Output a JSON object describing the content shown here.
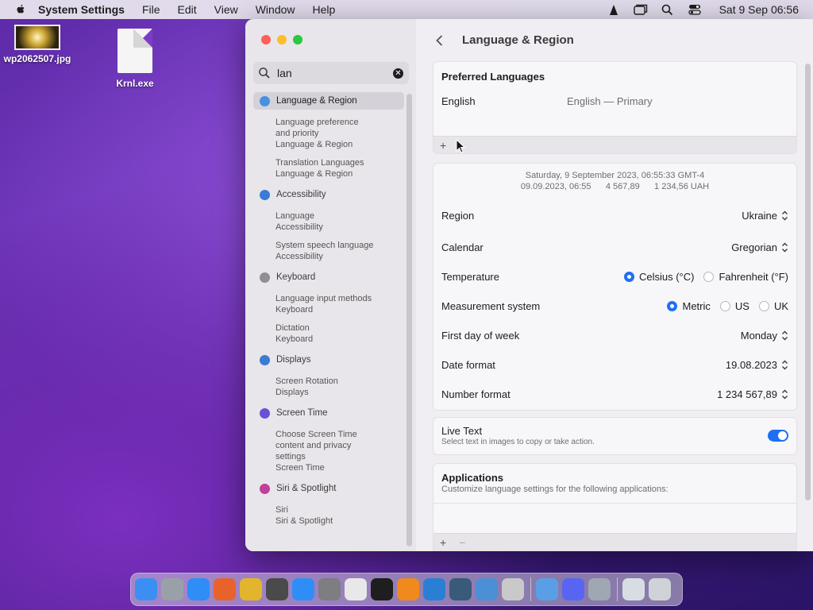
{
  "menubar": {
    "app_name": "System Settings",
    "menus": [
      "File",
      "Edit",
      "View",
      "Window",
      "Help"
    ],
    "clock": "Sat 9 Sep  06:56"
  },
  "desktop": {
    "items": [
      {
        "label": "wp2062507.jpg"
      },
      {
        "label": "Krnl.exe"
      }
    ]
  },
  "sidebar": {
    "search_value": "lan",
    "results": [
      {
        "category": "Language & Region",
        "icon": "globe-icon",
        "color": "#4a90e2",
        "selected": true,
        "subs": [
          [
            "Language preference",
            "and priority",
            "Language & Region"
          ],
          [
            "Translation Languages",
            "Language & Region"
          ]
        ]
      },
      {
        "category": "Accessibility",
        "icon": "accessibility-icon",
        "color": "#3a7bd5",
        "selected": false,
        "subs": [
          [
            "Language",
            "Accessibility"
          ],
          [
            "System speech language",
            "Accessibility"
          ]
        ]
      },
      {
        "category": "Keyboard",
        "icon": "keyboard-icon",
        "color": "#8e8e93",
        "selected": false,
        "subs": [
          [
            "Language input methods",
            "Keyboard"
          ],
          [
            "Dictation",
            "Keyboard"
          ]
        ]
      },
      {
        "category": "Displays",
        "icon": "displays-icon",
        "color": "#3a7bd5",
        "selected": false,
        "subs": [
          [
            "Screen Rotation",
            "Displays"
          ]
        ]
      },
      {
        "category": "Screen Time",
        "icon": "hourglass-icon",
        "color": "#6b4fd8",
        "selected": false,
        "subs": [
          [
            "Choose Screen Time",
            "content and privacy",
            "settings",
            "Screen Time"
          ]
        ]
      },
      {
        "category": "Siri & Spotlight",
        "icon": "siri-icon",
        "color": "#c0409b",
        "selected": false,
        "subs": [
          [
            "Siri",
            "Siri & Spotlight"
          ]
        ]
      }
    ]
  },
  "main": {
    "title": "Language & Region",
    "preferred": {
      "title": "Preferred Languages",
      "language": "English",
      "language_detail": "English — Primary",
      "add": "+"
    },
    "preview": {
      "line1": "Saturday, 9 September 2023, 06:55:33 GMT-4",
      "line2": "09.09.2023, 06:55      4 567,89      1 234,56 UAH"
    },
    "settings": {
      "region_label": "Region",
      "region_value": "Ukraine",
      "calendar_label": "Calendar",
      "calendar_value": "Gregorian",
      "temperature_label": "Temperature",
      "temp_c": "Celsius (°C)",
      "temp_f": "Fahrenheit (°F)",
      "measure_label": "Measurement system",
      "measure_metric": "Metric",
      "measure_us": "US",
      "measure_uk": "UK",
      "week_label": "First day of week",
      "week_value": "Monday",
      "date_label": "Date format",
      "date_value": "19.08.2023",
      "number_label": "Number format",
      "number_value": "1 234 567,89"
    },
    "live_text": {
      "title": "Live Text",
      "desc": "Select text in images to copy or take action."
    },
    "applications": {
      "title": "Applications",
      "desc": "Customize language settings for the following applications:",
      "add": "+",
      "remove": "−"
    }
  },
  "dock": {
    "apps": [
      {
        "icon": "finder-icon",
        "color": "#3b8ff3"
      },
      {
        "icon": "launchpad-icon",
        "color": "#9aa0a8"
      },
      {
        "icon": "safari-icon",
        "color": "#2e8ef5"
      },
      {
        "icon": "firefox-icon",
        "color": "#e8622c"
      },
      {
        "icon": "chrome-icon",
        "color": "#e3b52c"
      },
      {
        "icon": "guitar-icon",
        "color": "#4a4a4a"
      },
      {
        "icon": "appstore-icon",
        "color": "#2f8ef6"
      },
      {
        "icon": "settings-icon",
        "color": "#7d7d82"
      },
      {
        "icon": "textedit-icon",
        "color": "#e8e8e8"
      },
      {
        "icon": "terminal-icon",
        "color": "#1e1e1e"
      },
      {
        "icon": "vlc-icon",
        "color": "#f08a1c"
      },
      {
        "icon": "vscode-icon",
        "color": "#2a7fd4"
      },
      {
        "icon": "proxyman-icon",
        "color": "#3a5a7a"
      },
      {
        "icon": "network-icon",
        "color": "#4b8fd6"
      },
      {
        "icon": "wireless-icon",
        "color": "#c9c9c9"
      }
    ],
    "pinned": [
      {
        "icon": "weather-icon",
        "color": "#5a9fe6"
      },
      {
        "icon": "discord-icon",
        "color": "#5865f2"
      },
      {
        "icon": "preview-icon",
        "color": "#9fa7b3"
      }
    ],
    "extras": [
      {
        "icon": "folder-icon",
        "color": "#d8dde4"
      },
      {
        "icon": "trash-icon",
        "color": "#cfd3d8"
      }
    ]
  }
}
